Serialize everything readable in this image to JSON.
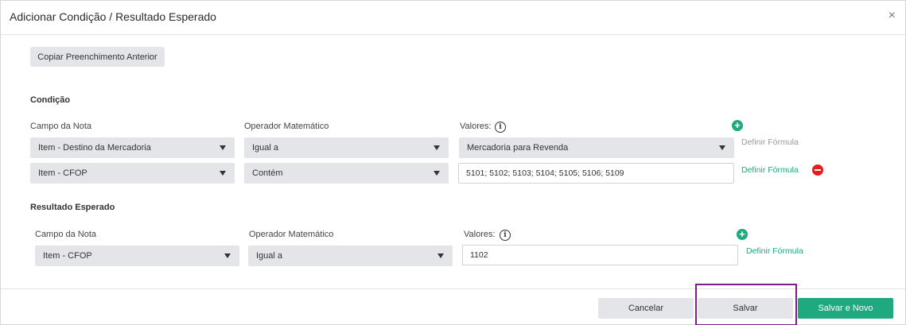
{
  "dialog": {
    "title": "Adicionar Condição / Resultado Esperado",
    "close_icon": "×",
    "copy_button": "Copiar Preenchimento Anterior"
  },
  "condition": {
    "title": "Condição",
    "col_field": "Campo da Nota",
    "col_operator": "Operador Matemático",
    "col_values": "Valores:",
    "info_icon": "i",
    "add_icon": "+",
    "rows": [
      {
        "field": "Item - Destino da Mercadoria",
        "operator": "Igual a",
        "value": "Mercadoria para Revenda",
        "formula": "Definir Fórmula"
      },
      {
        "field": "Item - CFOP",
        "operator": "Contém",
        "value": "5101; 5102; 5103; 5104; 5105; 5106; 5109",
        "formula": "Definir Fórmula"
      }
    ]
  },
  "result": {
    "title": "Resultado Esperado",
    "col_field": "Campo da Nota",
    "col_operator": "Operador Matemático",
    "col_values": "Valores:",
    "info_icon": "i",
    "add_icon": "+",
    "rows": [
      {
        "field": "Item - CFOP",
        "operator": "Igual a",
        "value": "1102",
        "formula": "Definir Fórmula"
      }
    ]
  },
  "footer": {
    "cancel": "Cancelar",
    "save": "Salvar",
    "save_new": "Salvar e Novo"
  },
  "colors": {
    "accent": "#1fa97f",
    "danger": "#e81c1c",
    "highlight": "#7b1f86",
    "field_bg": "#e3e5e9"
  }
}
